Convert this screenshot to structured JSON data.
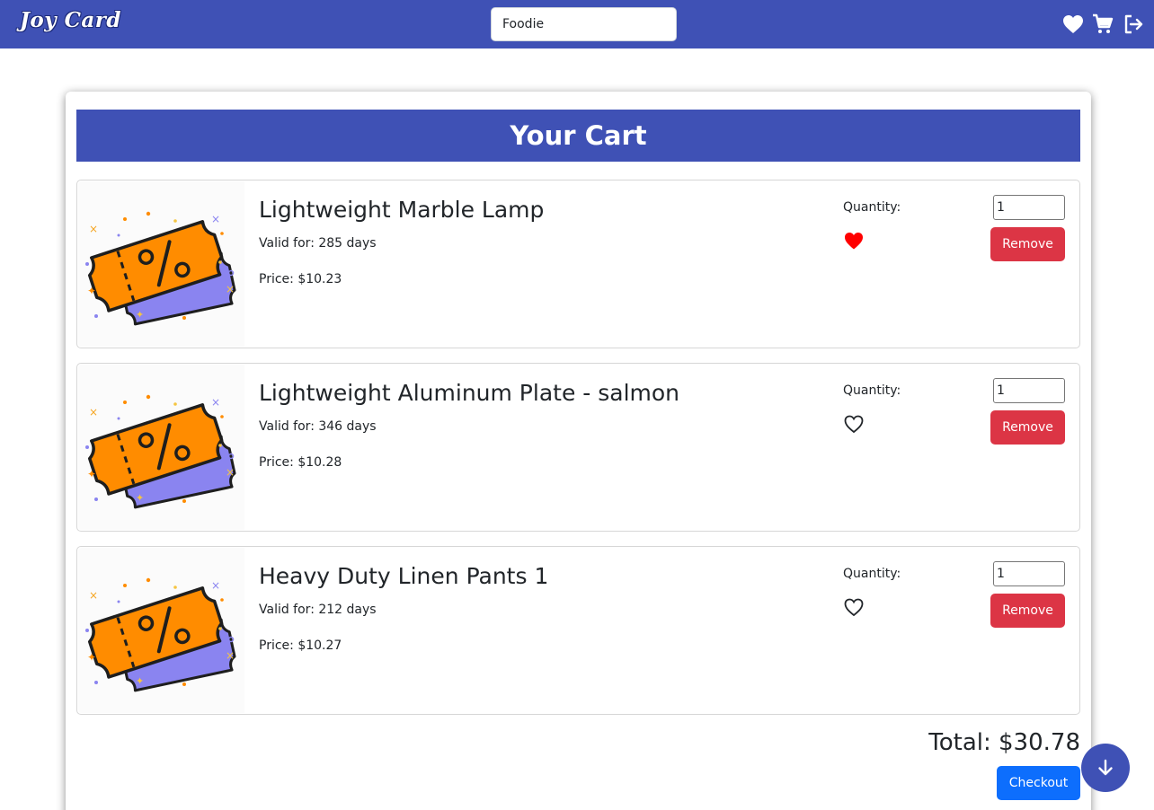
{
  "navbar": {
    "brand": "Joy Card",
    "search_value": "Foodie",
    "icons": [
      "heart-icon",
      "cart-icon",
      "logout-icon"
    ],
    "color": "#3f51b5"
  },
  "cart": {
    "title": "Your Cart",
    "quantity_label": "Quantity:",
    "remove_label": "Remove",
    "items": [
      {
        "name": "Lightweight Marble Lamp",
        "valid": "Valid for: 285 days",
        "price": "Price: $10.23",
        "quantity": "1",
        "favorited": true
      },
      {
        "name": "Lightweight Aluminum Plate - salmon",
        "valid": "Valid for: 346 days",
        "price": "Price: $10.28",
        "quantity": "1",
        "favorited": false
      },
      {
        "name": "Heavy Duty Linen Pants 1",
        "valid": "Valid for: 212 days",
        "price": "Price: $10.27",
        "quantity": "1",
        "favorited": false
      }
    ],
    "total": "Total: $30.78",
    "checkout_label": "Checkout"
  },
  "colors": {
    "primary": "#3f51b5",
    "danger": "#dc3545",
    "checkout": "#0d6efd",
    "heart_filled": "#ff0000"
  }
}
